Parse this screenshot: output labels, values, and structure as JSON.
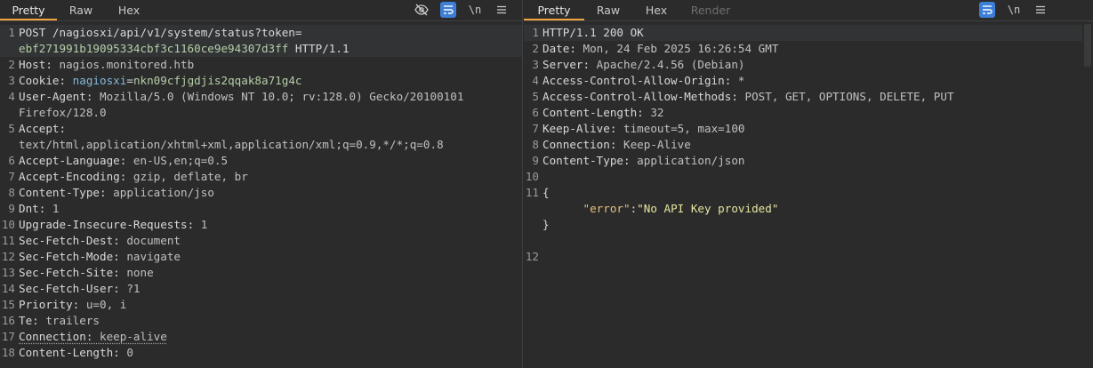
{
  "request": {
    "tabs": [
      "Pretty",
      "Raw",
      "Hex"
    ],
    "active_tab": "Pretty",
    "tools": {
      "hide": "eye-off-icon",
      "wrap": "wrap-icon",
      "newline_label": "\\n",
      "menu": "menu-icon"
    },
    "lines": {
      "l1a_method": "POST ",
      "l1a_path": "/nagiosxi/api/v1/system/status?token=",
      "l1b_token": "ebf271991b19095334cbf3c1160ce9e94307d3ff",
      "l1b_proto": " HTTP/1.1",
      "l2_name": "Host",
      "l2_val": "nagios.monitored.htb",
      "l3_name": "Cookie",
      "l3_ck": "nagiosxi",
      "l3_cv": "nkn09cfjgdjis2qqak8a71g4c",
      "l4_name": "User-Agent",
      "l4a_val": "Mozilla/5.0 (Windows NT 10.0; rv:128.0) Gecko/20100101",
      "l4b_val": "Firefox/128.0",
      "l5_name": "Accept",
      "l5b_val": "text/html,application/xhtml+xml,application/xml;q=0.9,*/*;q=0.8",
      "l6_name": "Accept-Language",
      "l6_val": "en-US,en;q=0.5",
      "l7_name": "Accept-Encoding",
      "l7_val": "gzip, deflate, br",
      "l8_name": "Content-Type",
      "l8_val": "application/jso",
      "l9_name": "Dnt",
      "l9_val": "1",
      "l10_name": "Upgrade-Insecure-Requests",
      "l10_val": "1",
      "l11_name": "Sec-Fetch-Dest",
      "l11_val": "document",
      "l12_name": "Sec-Fetch-Mode",
      "l12_val": "navigate",
      "l13_name": "Sec-Fetch-Site",
      "l13_val": "none",
      "l14_name": "Sec-Fetch-User",
      "l14_val": "?1",
      "l15_name": "Priority",
      "l15_val": "u=0, i",
      "l16_name": "Te",
      "l16_val": "trailers",
      "l17_name": "Connection",
      "l17_val": "keep-alive",
      "l18_name": "Content-Length",
      "l18_val": "0"
    }
  },
  "response": {
    "tabs": [
      "Pretty",
      "Raw",
      "Hex",
      "Render"
    ],
    "active_tab": "Pretty",
    "lines": {
      "r1": "HTTP/1.1 200 OK",
      "r2_name": "Date",
      "r2_val": "Mon, 24 Feb 2025 16:26:54 GMT",
      "r3_name": "Server",
      "r3_val": "Apache/2.4.56 (Debian)",
      "r4_name": "Access-Control-Allow-Origin",
      "r4_val": "*",
      "r5_name": "Access-Control-Allow-Methods",
      "r5_val": "POST, GET, OPTIONS, DELETE, PUT",
      "r6_name": "Content-Length",
      "r6_val": "32",
      "r7_name": "Keep-Alive",
      "r7_val": "timeout=5, max=100",
      "r8_name": "Connection",
      "r8_val": "Keep-Alive",
      "r9_name": "Content-Type",
      "r9_val": "application/json",
      "r11_open": "{",
      "r11_key": "\"error\"",
      "r11_colon": ":",
      "r11_val": "\"No API Key provided\"",
      "r11_close": "}"
    }
  },
  "colors": {
    "accent_tab": "#f0a742",
    "wrap_button": "#3d7fd6",
    "background": "#2b2b2b"
  }
}
